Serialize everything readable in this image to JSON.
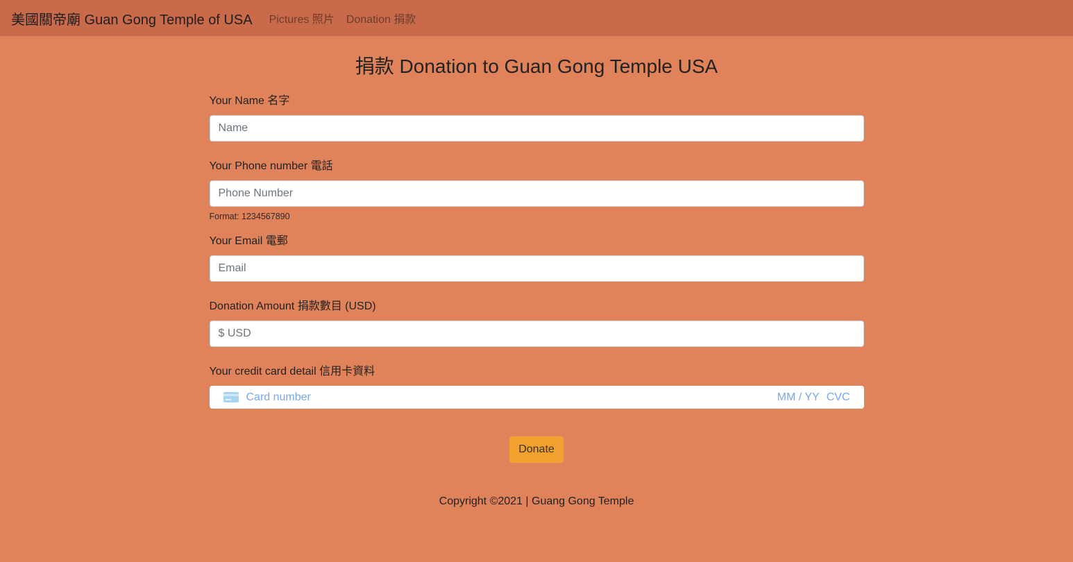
{
  "navbar": {
    "brand": "美國關帝廟 Guan Gong Temple of USA",
    "links": [
      {
        "label": "Pictures 照片"
      },
      {
        "label": "Donation 捐款"
      }
    ]
  },
  "page": {
    "title": "捐款 Donation to Guan Gong Temple USA"
  },
  "form": {
    "name": {
      "label": "Your Name 名字",
      "placeholder": "Name",
      "value": ""
    },
    "phone": {
      "label": "Your Phone number 電話",
      "placeholder": "Phone Number",
      "value": "",
      "help": "Format: 1234567890"
    },
    "email": {
      "label": "Your Email 電郵",
      "placeholder": "Email",
      "value": ""
    },
    "amount": {
      "label": "Donation Amount 捐款數目 (USD)",
      "placeholder": "$ USD",
      "value": ""
    },
    "card": {
      "label": "Your credit card detail 信用卡資料",
      "number_placeholder": "Card number",
      "exp_placeholder": "MM / YY",
      "cvc_placeholder": "CVC",
      "icon": "credit-card-icon"
    },
    "submit_label": "Donate"
  },
  "footer": {
    "copyright": "Copyright ©2021 | Guang Gong Temple"
  },
  "colors": {
    "background": "#e0835b",
    "navbar": "#c96a4b",
    "button": "#f2a12e",
    "card_placeholder": "#7aa7e6"
  }
}
